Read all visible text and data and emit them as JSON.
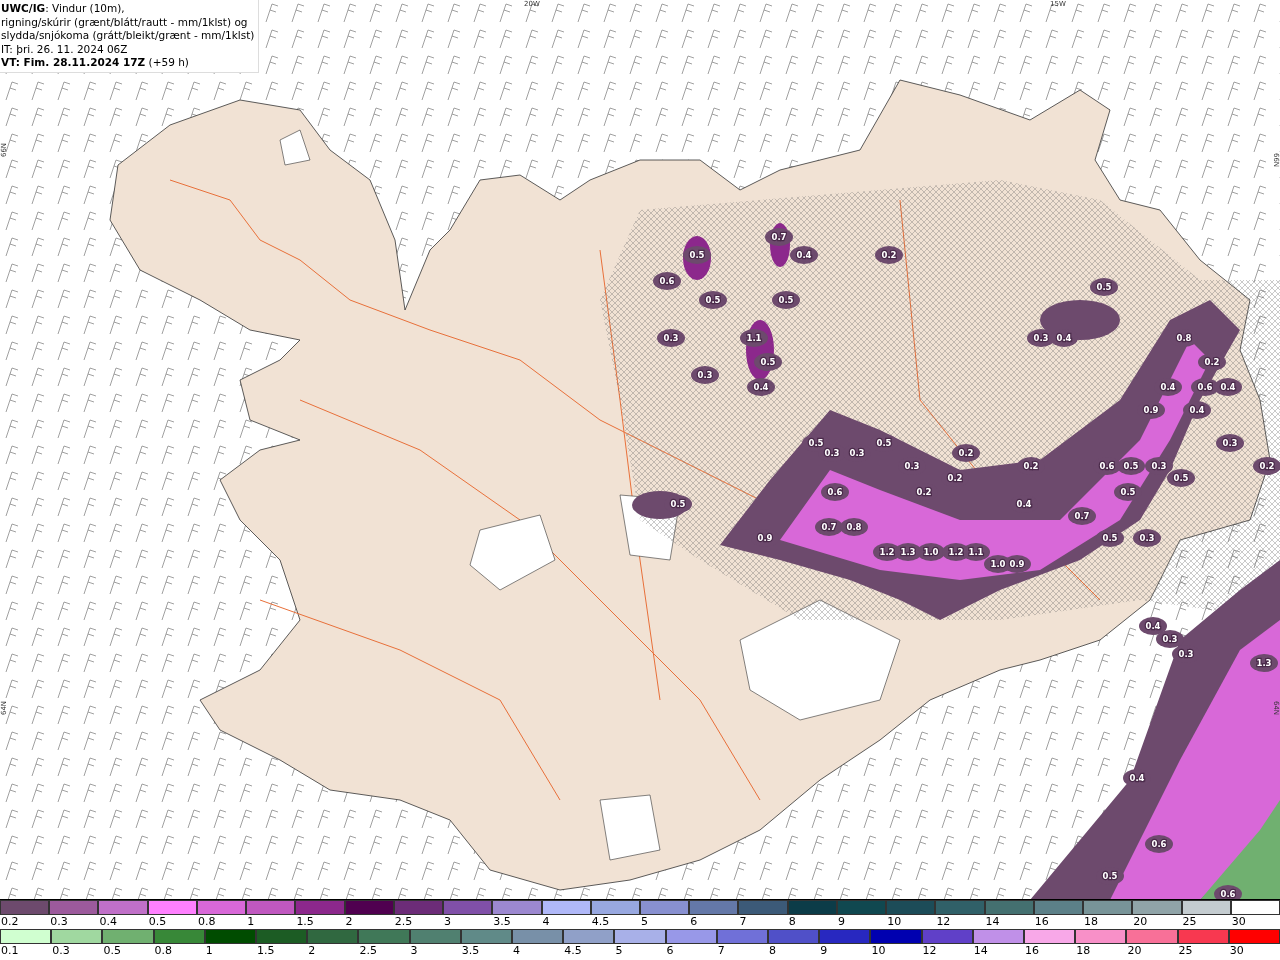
{
  "caption": {
    "lines": [
      "**UWC/IG**: Vindur (10m),",
      "rigning/skúrir (grænt/blátt/rautt - mm/1klst) og",
      "slydda/snjókoma (grátt/bleikt/grænt - mm/1klst)",
      "IT: þri. 26. 11. 2024 06Z",
      "**VT: Fim. 28.11.2024 17Z** (+59 h)"
    ]
  },
  "map": {
    "longitude_labels": [
      "20W",
      "15W"
    ],
    "latitude_labels": [
      "66N",
      "64N",
      "66N",
      "64N"
    ],
    "value_labels": [
      "0.7",
      "0.5",
      "0.4",
      "0.2",
      "0.6",
      "0.5",
      "0.5",
      "0.5",
      "0.3",
      "1.1",
      "0.3",
      "0.4",
      "0.8",
      "0.5",
      "0.2",
      "0.3",
      "0.4",
      "0.4",
      "0.6",
      "0.4",
      "0.9",
      "0.4",
      "0.5",
      "0.5",
      "0.3",
      "0.3",
      "0.3",
      "0.2",
      "0.3",
      "0.2",
      "0.6",
      "0.5",
      "0.3",
      "0.2",
      "0.2",
      "0.5",
      "0.6",
      "0.2",
      "0.5",
      "0.5",
      "0.4",
      "0.7",
      "0.7",
      "0.8",
      "0.9",
      "0.5",
      "0.3",
      "1.2",
      "1.3",
      "1.0",
      "1.2",
      "1.1",
      "1.0",
      "0.9",
      "0.4",
      "0.3",
      "0.3",
      "1.3",
      "0.4",
      "0.6",
      "0.5",
      "0.6"
    ]
  },
  "legend": {
    "rows": [
      {
        "swatches": [
          {
            "color": "#6d4a6d",
            "label": "0.2"
          },
          {
            "color": "#9c5a9c",
            "label": "0.3"
          },
          {
            "color": "#c070c8",
            "label": "0.4"
          },
          {
            "color": "#ff80ff",
            "label": "0.5"
          },
          {
            "color": "#d868d8",
            "label": "0.8"
          },
          {
            "color": "#c058c0",
            "label": "1"
          },
          {
            "color": "#8c288c",
            "label": "1.5"
          },
          {
            "color": "#500050",
            "label": "2"
          },
          {
            "color": "#6c2c78",
            "label": "2.5"
          },
          {
            "color": "#8050a8",
            "label": "3"
          },
          {
            "color": "#9c88d0",
            "label": "3.5"
          },
          {
            "color": "#b0b8f8",
            "label": "4"
          },
          {
            "color": "#98a8e0",
            "label": "4.5"
          },
          {
            "color": "#8890d0",
            "label": "5"
          },
          {
            "color": "#6478a8",
            "label": "6"
          },
          {
            "color": "#3c5a78",
            "label": "7"
          },
          {
            "color": "#0c3c48",
            "label": "8"
          },
          {
            "color": "#104850",
            "label": "9"
          },
          {
            "color": "#1c4c58",
            "label": "10"
          },
          {
            "color": "#306068",
            "label": "12"
          },
          {
            "color": "#447070",
            "label": "14"
          },
          {
            "color": "#5c8088",
            "label": "16"
          },
          {
            "color": "#789498",
            "label": "18"
          },
          {
            "color": "#90a4a8",
            "label": "20"
          },
          {
            "color": "#c4ccd0",
            "label": "25"
          },
          {
            "color": "#ffffff",
            "label": "30"
          }
        ]
      },
      {
        "swatches": [
          {
            "color": "#d0ffd0",
            "label": "0.1"
          },
          {
            "color": "#a0d8a0",
            "label": "0.3"
          },
          {
            "color": "#70b070",
            "label": "0.5"
          },
          {
            "color": "#388838",
            "label": "0.8"
          },
          {
            "color": "#004c00",
            "label": "1"
          },
          {
            "color": "#1c5c24",
            "label": "1.5"
          },
          {
            "color": "#306840",
            "label": "2"
          },
          {
            "color": "#407858",
            "label": "2.5"
          },
          {
            "color": "#508070",
            "label": "3"
          },
          {
            "color": "#608a88",
            "label": "3.5"
          },
          {
            "color": "#7890a8",
            "label": "4"
          },
          {
            "color": "#90a0c8",
            "label": "4.5"
          },
          {
            "color": "#a8b0e8",
            "label": "5"
          },
          {
            "color": "#9898e8",
            "label": "6"
          },
          {
            "color": "#7070d8",
            "label": "7"
          },
          {
            "color": "#5050c8",
            "label": "8"
          },
          {
            "color": "#2828c0",
            "label": "9"
          },
          {
            "color": "#0000b0",
            "label": "10"
          },
          {
            "color": "#6040c8",
            "label": "12"
          },
          {
            "color": "#c090e8",
            "label": "14"
          },
          {
            "color": "#f8a8e8",
            "label": "16"
          },
          {
            "color": "#f890c8",
            "label": "18"
          },
          {
            "color": "#f87098",
            "label": "20"
          },
          {
            "color": "#f83850",
            "label": "25"
          },
          {
            "color": "#ff0000",
            "label": "30"
          }
        ]
      }
    ]
  }
}
